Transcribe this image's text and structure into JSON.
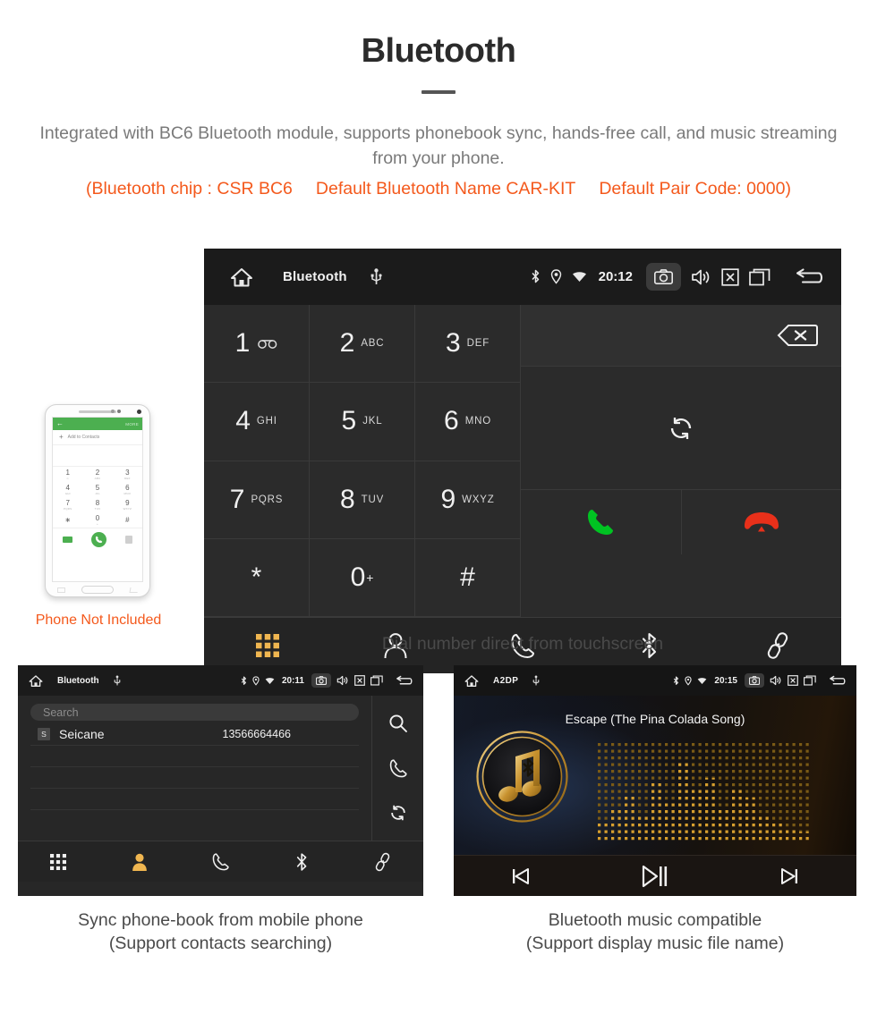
{
  "header": {
    "title": "Bluetooth",
    "subtitle": "Integrated with BC6 Bluetooth module, supports phonebook sync, hands-free call, and music streaming from your phone.",
    "spec_open": "(Bluetooth chip : CSR BC6",
    "spec_name": "Default Bluetooth Name CAR-KIT",
    "spec_pair": "Default Pair Code: 0000)",
    "accent_color": "#f4591c",
    "subtitle_color": "#7a7a7a"
  },
  "dialer": {
    "statusbar": {
      "home_icon": "home-icon",
      "title": "Bluetooth",
      "usb_icon": "usb-icon",
      "bluetooth_icon": "bluetooth-icon",
      "location_icon": "location-icon",
      "wifi_icon": "wifi-icon",
      "time": "20:12",
      "camera_icon": "camera-icon",
      "volume_icon": "volume-icon",
      "close_icon": "close-box-icon",
      "recents_icon": "recent-apps-icon",
      "back_icon": "back-icon"
    },
    "keys": [
      {
        "num": "1",
        "sub": "",
        "icon": "voicemail-icon"
      },
      {
        "num": "2",
        "sub": "ABC",
        "icon": ""
      },
      {
        "num": "3",
        "sub": "DEF",
        "icon": ""
      },
      {
        "num": "4",
        "sub": "GHI",
        "icon": ""
      },
      {
        "num": "5",
        "sub": "JKL",
        "icon": ""
      },
      {
        "num": "6",
        "sub": "MNO",
        "icon": ""
      },
      {
        "num": "7",
        "sub": "PQRS",
        "icon": ""
      },
      {
        "num": "8",
        "sub": "TUV",
        "icon": ""
      },
      {
        "num": "9",
        "sub": "WXYZ",
        "icon": ""
      },
      {
        "num": "*",
        "sub": "",
        "icon": ""
      },
      {
        "num": "0",
        "sup": "+",
        "sub": "",
        "icon": ""
      },
      {
        "num": "#",
        "sub": "",
        "icon": ""
      }
    ],
    "actions": {
      "backspace_icon": "backspace-icon",
      "sync_icon": "sync-icon",
      "call_icon": "call-icon",
      "hangup_icon": "hangup-icon",
      "call_color": "#00c322",
      "hangup_color": "#e8301a"
    },
    "bottomnav": [
      {
        "icon": "keypad-icon",
        "active": true
      },
      {
        "icon": "contacts-icon",
        "active": false
      },
      {
        "icon": "call-history-icon",
        "active": false
      },
      {
        "icon": "bluetooth-icon",
        "active": false
      },
      {
        "icon": "link-pair-icon",
        "active": false
      }
    ],
    "active_color": "#f0b650"
  },
  "phone_mock": {
    "app_more_label": "MORE",
    "add_contacts_label": "Add to Contacts",
    "keys": [
      {
        "n": "1",
        "l": "∞"
      },
      {
        "n": "2",
        "l": "ABC"
      },
      {
        "n": "3",
        "l": "DEF"
      },
      {
        "n": "4",
        "l": "GHI"
      },
      {
        "n": "5",
        "l": "JKL"
      },
      {
        "n": "6",
        "l": "MNO"
      },
      {
        "n": "7",
        "l": "PQRS"
      },
      {
        "n": "8",
        "l": "TUV"
      },
      {
        "n": "9",
        "l": "WXYZ"
      },
      {
        "n": "∗",
        "l": ""
      },
      {
        "n": "0",
        "l": "+"
      },
      {
        "n": "#",
        "l": ""
      }
    ],
    "note": "Phone Not Included",
    "note_color": "#f4591c"
  },
  "captions": {
    "main": "Dial number direct from touchscreen",
    "left_line1": "Sync phone-book from mobile phone",
    "left_line2": "(Support contacts searching)",
    "right_line1": "Bluetooth music compatible",
    "right_line2": "(Support display music file name)"
  },
  "phonebook": {
    "statusbar": {
      "title": "Bluetooth",
      "time": "20:11"
    },
    "search_placeholder": "Search",
    "contacts": [
      {
        "initial": "S",
        "name": "Seicane",
        "number": "13566664466"
      }
    ],
    "rail": [
      {
        "icon": "search-icon"
      },
      {
        "icon": "call-icon"
      },
      {
        "icon": "sync-icon"
      }
    ],
    "bottomnav": [
      {
        "icon": "keypad-icon",
        "active": false
      },
      {
        "icon": "contacts-icon",
        "active": true
      },
      {
        "icon": "call-history-icon",
        "active": false
      },
      {
        "icon": "bluetooth-icon",
        "active": false
      },
      {
        "icon": "link-pair-icon",
        "active": false
      }
    ]
  },
  "music": {
    "statusbar": {
      "title": "A2DP",
      "time": "20:15"
    },
    "song_title": "Escape (The Pina Colada Song)",
    "logo_icon": "bluetooth-music-note-icon",
    "visualizer": "dot-matrix-equalizer",
    "controls": [
      {
        "icon": "previous-track-icon"
      },
      {
        "icon": "play-pause-icon"
      },
      {
        "icon": "next-track-icon"
      }
    ],
    "gold_color": "#c99a3b"
  }
}
